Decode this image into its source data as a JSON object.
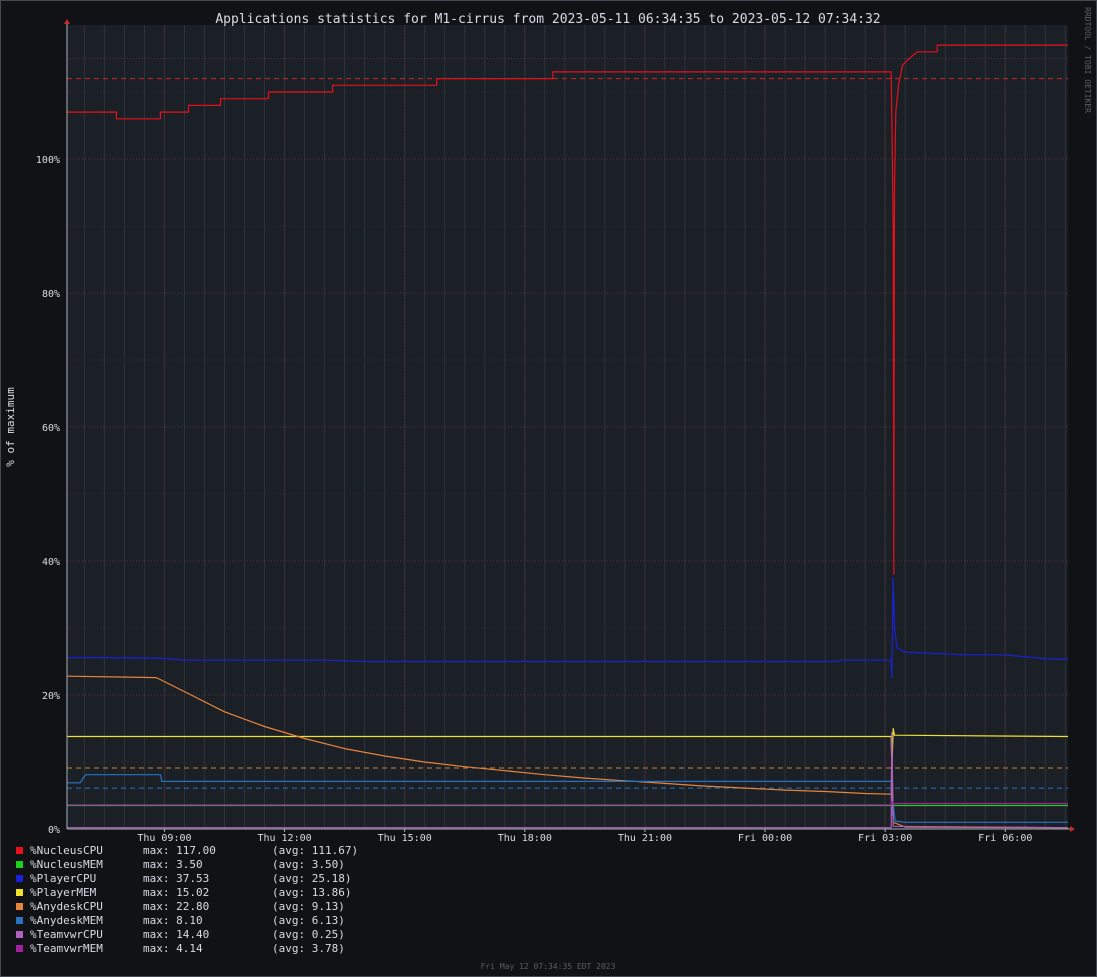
{
  "chart_data": {
    "type": "line",
    "title": "Applications statistics for M1-cirrus from 2023-05-11 06:34:35 to 2023-05-12 07:34:32",
    "ylabel": "% of maximum",
    "xlabel": "",
    "side_label": "RRDTOOL / TOBI OETIKER",
    "footer": "Fri May 12 07:34:35 EDT 2023",
    "x_range": [
      "2023-05-11 06:34",
      "2023-05-12 07:34"
    ],
    "ylim": [
      0,
      120
    ],
    "y_ticks": [
      0,
      20,
      40,
      60,
      80,
      100
    ],
    "y_tick_labels": [
      "0%",
      "20%",
      "40%",
      "60%",
      "80%",
      "100%"
    ],
    "x_ticks": [
      "2023-05-11 09:00",
      "2023-05-11 12:00",
      "2023-05-11 15:00",
      "2023-05-11 18:00",
      "2023-05-11 21:00",
      "2023-05-12 00:00",
      "2023-05-12 03:00",
      "2023-05-12 06:00"
    ],
    "x_tick_labels": [
      "Thu 09:00",
      "Thu 12:00",
      "Thu 15:00",
      "Thu 18:00",
      "Thu 21:00",
      "Fri 00:00",
      "Fri 03:00",
      "Fri 06:00"
    ],
    "grid": true,
    "legend_position": "bottom",
    "hrules": [
      {
        "value": 112,
        "color": "#c62a2a"
      },
      {
        "value": 9.1,
        "color": "#c8802e"
      },
      {
        "value": 6.1,
        "color": "#2a72c0"
      }
    ],
    "series": [
      {
        "name": "%NucleusCPU",
        "max_text": "max: 117.00",
        "avg_text": "(avg: 111.67)",
        "color": "#e8101a",
        "points": [
          [
            "2023-05-11 06:34",
            107
          ],
          [
            "2023-05-11 07:48",
            107
          ],
          [
            "2023-05-11 07:48",
            106
          ],
          [
            "2023-05-11 08:54",
            106
          ],
          [
            "2023-05-11 08:54",
            107
          ],
          [
            "2023-05-11 09:36",
            107
          ],
          [
            "2023-05-11 09:36",
            108
          ],
          [
            "2023-05-11 10:24",
            108
          ],
          [
            "2023-05-11 10:24",
            109
          ],
          [
            "2023-05-11 11:36",
            109
          ],
          [
            "2023-05-11 11:36",
            110
          ],
          [
            "2023-05-11 13:12",
            110
          ],
          [
            "2023-05-11 13:12",
            111
          ],
          [
            "2023-05-11 15:48",
            111
          ],
          [
            "2023-05-11 15:48",
            112
          ],
          [
            "2023-05-11 18:42",
            112
          ],
          [
            "2023-05-11 18:42",
            113
          ],
          [
            "2023-05-12 03:09",
            113
          ],
          [
            "2023-05-12 03:12",
            90
          ],
          [
            "2023-05-12 03:13",
            38
          ],
          [
            "2023-05-12 03:14",
            96
          ],
          [
            "2023-05-12 03:16",
            107
          ],
          [
            "2023-05-12 03:20",
            111
          ],
          [
            "2023-05-12 03:26",
            114
          ],
          [
            "2023-05-12 03:36",
            115
          ],
          [
            "2023-05-12 03:48",
            116
          ],
          [
            "2023-05-12 04:18",
            116
          ],
          [
            "2023-05-12 04:18",
            117
          ],
          [
            "2023-05-12 07:34",
            117
          ]
        ]
      },
      {
        "name": "%NucleusMEM",
        "max_text": "max: 3.50",
        "avg_text": "(avg: 3.50)",
        "color": "#20d020",
        "points": [
          [
            "2023-05-11 06:34",
            3.5
          ],
          [
            "2023-05-12 07:34",
            3.5
          ]
        ]
      },
      {
        "name": "%PlayerCPU",
        "max_text": "max: 37.53",
        "avg_text": "(avg: 25.18)",
        "color": "#1a22d8",
        "points": [
          [
            "2023-05-11 06:34",
            25.6
          ],
          [
            "2023-05-11 08:54",
            25.5
          ],
          [
            "2023-05-11 09:30",
            25.2
          ],
          [
            "2023-05-11 13:00",
            25.2
          ],
          [
            "2023-05-11 14:00",
            25.0
          ],
          [
            "2023-05-12 01:48",
            25.0
          ],
          [
            "2023-05-12 01:54",
            25.2
          ],
          [
            "2023-05-12 03:09",
            25.2
          ],
          [
            "2023-05-12 03:10",
            22.5
          ],
          [
            "2023-05-12 03:12",
            37.5
          ],
          [
            "2023-05-12 03:14",
            30.0
          ],
          [
            "2023-05-12 03:18",
            27.0
          ],
          [
            "2023-05-12 03:30",
            26.4
          ],
          [
            "2023-05-12 05:00",
            26.0
          ],
          [
            "2023-05-12 06:00",
            26.0
          ],
          [
            "2023-05-12 07:00",
            25.4
          ],
          [
            "2023-05-12 07:34",
            25.3
          ]
        ]
      },
      {
        "name": "%PlayerMEM",
        "max_text": "max: 15.02",
        "avg_text": "(avg: 13.86)",
        "color": "#f0e030",
        "points": [
          [
            "2023-05-11 06:34",
            13.8
          ],
          [
            "2023-05-12 03:09",
            13.8
          ],
          [
            "2023-05-12 03:10",
            8.8
          ],
          [
            "2023-05-12 03:12",
            15.0
          ],
          [
            "2023-05-12 03:14",
            14.0
          ],
          [
            "2023-05-12 07:34",
            13.8
          ]
        ]
      },
      {
        "name": "%AnydeskCPU",
        "max_text": "max: 22.80",
        "avg_text": "(avg: 9.13)",
        "color": "#e8843a",
        "points": [
          [
            "2023-05-11 06:34",
            22.8
          ],
          [
            "2023-05-11 08:48",
            22.6
          ],
          [
            "2023-05-11 09:30",
            20.5
          ],
          [
            "2023-05-11 10:30",
            17.5
          ],
          [
            "2023-05-11 11:30",
            15.3
          ],
          [
            "2023-05-11 12:30",
            13.5
          ],
          [
            "2023-05-11 13:30",
            12.0
          ],
          [
            "2023-05-11 14:30",
            10.9
          ],
          [
            "2023-05-11 15:30",
            10.0
          ],
          [
            "2023-05-11 16:30",
            9.3
          ],
          [
            "2023-05-11 17:30",
            8.7
          ],
          [
            "2023-05-11 18:30",
            8.1
          ],
          [
            "2023-05-11 19:30",
            7.6
          ],
          [
            "2023-05-11 20:30",
            7.2
          ],
          [
            "2023-05-11 21:30",
            6.8
          ],
          [
            "2023-05-11 22:30",
            6.4
          ],
          [
            "2023-05-11 23:30",
            6.1
          ],
          [
            "2023-05-12 00:30",
            5.8
          ],
          [
            "2023-05-12 01:30",
            5.6
          ],
          [
            "2023-05-12 02:30",
            5.3
          ],
          [
            "2023-05-12 03:09",
            5.2
          ],
          [
            "2023-05-12 03:10",
            12.0
          ],
          [
            "2023-05-12 03:12",
            1.0
          ],
          [
            "2023-05-12 03:30",
            0.3
          ],
          [
            "2023-05-12 07:34",
            0.2
          ]
        ]
      },
      {
        "name": "%AnydeskMEM",
        "max_text": "max: 8.10",
        "avg_text": "(avg: 6.13)",
        "color": "#2a72c0",
        "points": [
          [
            "2023-05-11 06:34",
            6.9
          ],
          [
            "2023-05-11 06:54",
            6.9
          ],
          [
            "2023-05-11 06:58",
            7.6
          ],
          [
            "2023-05-11 07:02",
            8.1
          ],
          [
            "2023-05-11 08:54",
            8.1
          ],
          [
            "2023-05-11 08:56",
            7.1
          ],
          [
            "2023-05-12 03:09",
            7.1
          ],
          [
            "2023-05-12 03:10",
            2.0
          ],
          [
            "2023-05-12 03:12",
            3.5
          ],
          [
            "2023-05-12 03:15",
            1.2
          ],
          [
            "2023-05-12 03:30",
            1.0
          ],
          [
            "2023-05-12 07:34",
            1.0
          ]
        ]
      },
      {
        "name": "%TeamvwrCPU",
        "max_text": "max: 14.40",
        "avg_text": "(avg: 0.25)",
        "color": "#b060c0",
        "points": [
          [
            "2023-05-11 06:34",
            0.2
          ],
          [
            "2023-05-12 03:09",
            0.2
          ],
          [
            "2023-05-12 03:10",
            14.4
          ],
          [
            "2023-05-12 03:12",
            0.4
          ],
          [
            "2023-05-12 07:34",
            0.2
          ]
        ]
      },
      {
        "name": "%TeamvwrMEM",
        "max_text": "max: 4.14",
        "avg_text": "(avg: 3.78)",
        "color": "#a020a0",
        "points": [
          [
            "2023-05-11 06:34",
            3.6
          ],
          [
            "2023-05-12 03:09",
            3.6
          ],
          [
            "2023-05-12 03:10",
            4.14
          ],
          [
            "2023-05-12 03:12",
            3.8
          ],
          [
            "2023-05-12 07:34",
            3.8
          ]
        ]
      }
    ]
  }
}
